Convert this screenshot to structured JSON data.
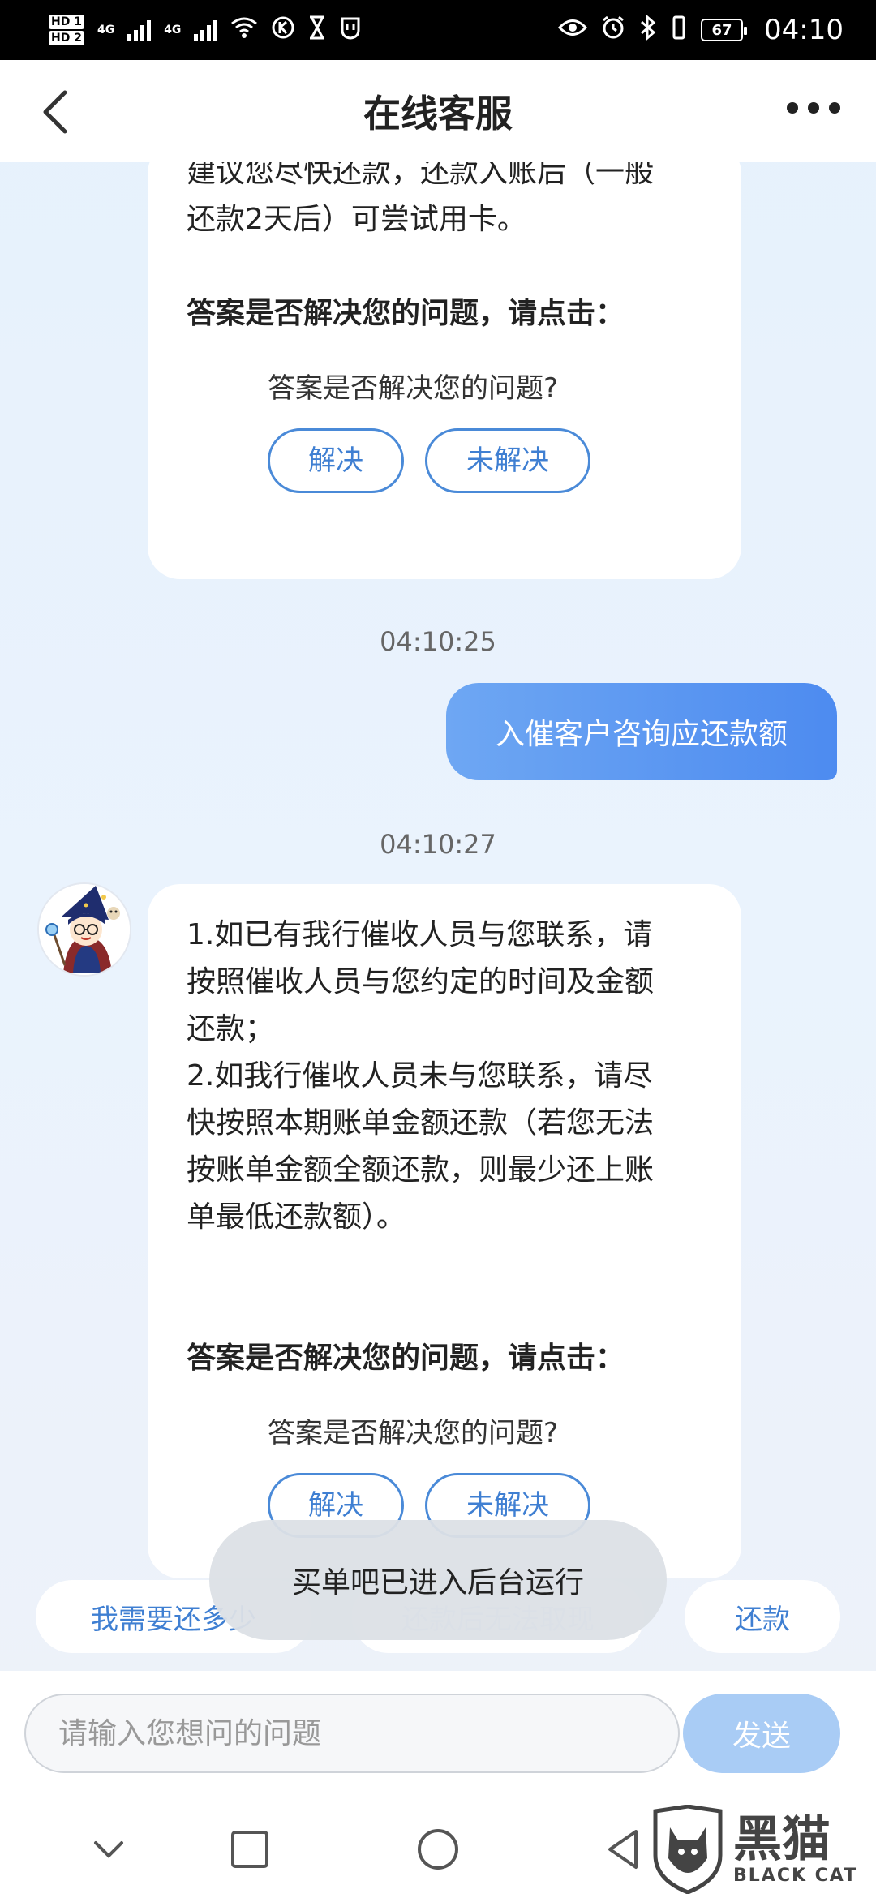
{
  "status_bar": {
    "hd1": "HD 1",
    "hd2": "HD 2",
    "sig1": "4G",
    "sig2": "4G",
    "battery": "67",
    "time": "04:10"
  },
  "header": {
    "title": "在线客服"
  },
  "messages": {
    "bot1": {
      "lines": [
        "建议您尽快还款，还款入账后（一般",
        "还款2天后）可尝试用卡。"
      ],
      "feedback_title": "答案是否解决您的问题，请点击：",
      "feedback_question": "答案是否解决您的问题?",
      "resolved_label": "解决",
      "unresolved_label": "未解决"
    },
    "time1": "04:10:25",
    "user1": "入催客户咨询应还款额",
    "time2": "04:10:27",
    "bot2": {
      "lines": [
        "1.如已有我行催收人员与您联系，请",
        "按照催收人员与您约定的时间及金额",
        "还款；",
        "2.如我行催收人员未与您联系，请尽",
        "快按照本期账单金额还款（若您无法",
        "按账单金额全额还款，则最少还上账",
        "单最低还款额）。"
      ],
      "feedback_title": "答案是否解决您的问题，请点击：",
      "feedback_question": "答案是否解决您的问题?",
      "resolved_label": "解决",
      "unresolved_label": "未解决"
    }
  },
  "quick_replies": [
    "我需要还多少",
    "还款后无法取现",
    "还款"
  ],
  "toast": "买单吧已进入后台运行",
  "input": {
    "placeholder": "请输入您想问的问题",
    "send_label": "发送"
  },
  "watermark": {
    "cn": "黑猫",
    "en": "BLACK CAT"
  },
  "colors": {
    "accent": "#4a8ad8",
    "user_bubble": "#5b95f2",
    "send_disabled": "#a9ccf5"
  }
}
